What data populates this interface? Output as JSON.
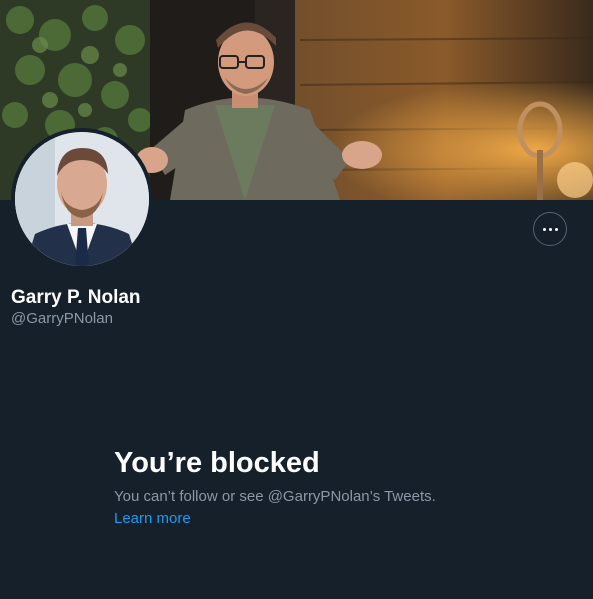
{
  "profile": {
    "display_name": "Garry P. Nolan",
    "handle": "@GarryPNolan"
  },
  "banner": {
    "image": "banner-photo"
  },
  "avatar": {
    "image": "profile-avatar-photo"
  },
  "actions": {
    "more_icon": "more-horizontal-icon"
  },
  "blocked": {
    "title": "You’re blocked",
    "description": "You can’t follow or see @GarryPNolan’s Tweets.",
    "learn_more": "Learn more"
  },
  "colors": {
    "background": "#15202b",
    "text_primary": "#ffffff",
    "text_secondary": "#8b98a5",
    "link": "#1d9bf0",
    "border": "#536471"
  }
}
